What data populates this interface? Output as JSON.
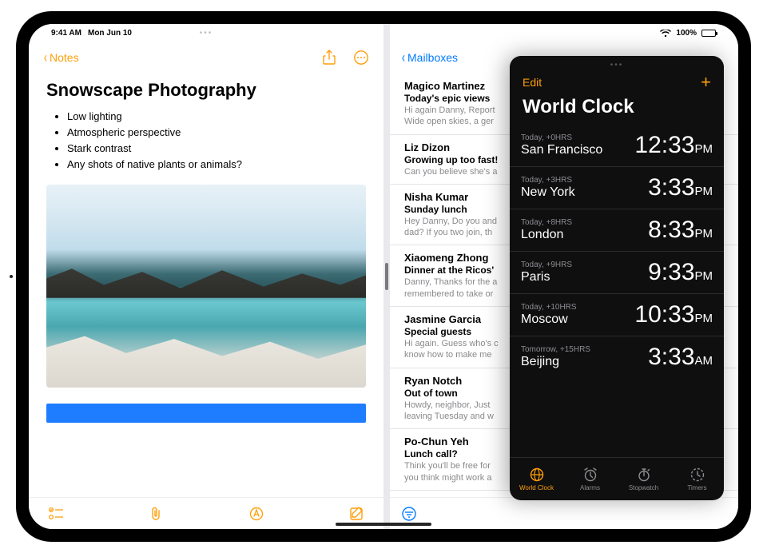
{
  "status": {
    "time": "9:41 AM",
    "date": "Mon Jun 10",
    "battery_pct": "100%"
  },
  "notes": {
    "back_label": "Notes",
    "title": "Snowscape Photography",
    "bullets": [
      "Low lighting",
      "Atmospheric perspective",
      "Stark contrast",
      "Any shots of native plants or animals?"
    ]
  },
  "mail": {
    "back_label": "Mailboxes",
    "items": [
      {
        "sender": "Magico Martinez",
        "subject": "Today's epic views",
        "preview_l1": "Hi again Danny, Report",
        "preview_l2": "Wide open skies, a ger"
      },
      {
        "sender": "Liz Dizon",
        "subject": "Growing up too fast!",
        "preview_l1": "Can you believe she's a",
        "preview_l2": ""
      },
      {
        "sender": "Nisha Kumar",
        "subject": "Sunday lunch",
        "preview_l1": "Hey Danny, Do you and",
        "preview_l2": "dad? If you two join, th"
      },
      {
        "sender": "Xiaomeng Zhong",
        "subject": "Dinner at the Ricos'",
        "preview_l1": "Danny, Thanks for the a",
        "preview_l2": "remembered to take or"
      },
      {
        "sender": "Jasmine Garcia",
        "subject": "Special guests",
        "preview_l1": "Hi again. Guess who's c",
        "preview_l2": "know how to make me"
      },
      {
        "sender": "Ryan Notch",
        "subject": "Out of town",
        "preview_l1": "Howdy, neighbor, Just",
        "preview_l2": "leaving Tuesday and w"
      },
      {
        "sender": "Po-Chun Yeh",
        "subject": "Lunch call?",
        "preview_l1": "Think you'll be free for",
        "preview_l2": "you think might work a"
      }
    ]
  },
  "clock": {
    "edit": "Edit",
    "title": "World Clock",
    "cities": [
      {
        "offset": "Today, +0HRS",
        "city": "San Francisco",
        "time": "12:33",
        "ampm": "PM"
      },
      {
        "offset": "Today, +3HRS",
        "city": "New York",
        "time": "3:33",
        "ampm": "PM"
      },
      {
        "offset": "Today, +8HRS",
        "city": "London",
        "time": "8:33",
        "ampm": "PM"
      },
      {
        "offset": "Today, +9HRS",
        "city": "Paris",
        "time": "9:33",
        "ampm": "PM"
      },
      {
        "offset": "Today, +10HRS",
        "city": "Moscow",
        "time": "10:33",
        "ampm": "PM"
      },
      {
        "offset": "Tomorrow, +15HRS",
        "city": "Beijing",
        "time": "3:33",
        "ampm": "AM"
      }
    ],
    "tabs": [
      {
        "label": "World Clock",
        "icon": "globe"
      },
      {
        "label": "Alarms",
        "icon": "alarm"
      },
      {
        "label": "Stopwatch",
        "icon": "stopwatch"
      },
      {
        "label": "Timers",
        "icon": "timer"
      }
    ]
  }
}
